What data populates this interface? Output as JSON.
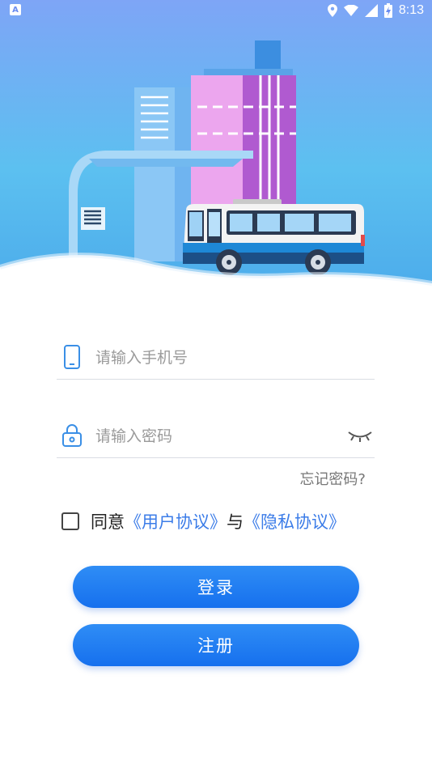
{
  "status_bar": {
    "time": "8:13",
    "notification_glyph": "A"
  },
  "form": {
    "phone_placeholder": "请输入手机号",
    "password_placeholder": "请输入密码",
    "forgot_password": "忘记密码?"
  },
  "agreement": {
    "prefix": "同意",
    "user_agreement": "《用户协议》",
    "conjunction": "与",
    "privacy_agreement": "《隐私协议》"
  },
  "buttons": {
    "login": "登录",
    "register": "注册"
  },
  "colors": {
    "accent": "#2f8df5",
    "link": "#3b7ce8",
    "sky_top": "#7fa8f5",
    "sky_bottom": "#4fc4ee"
  }
}
